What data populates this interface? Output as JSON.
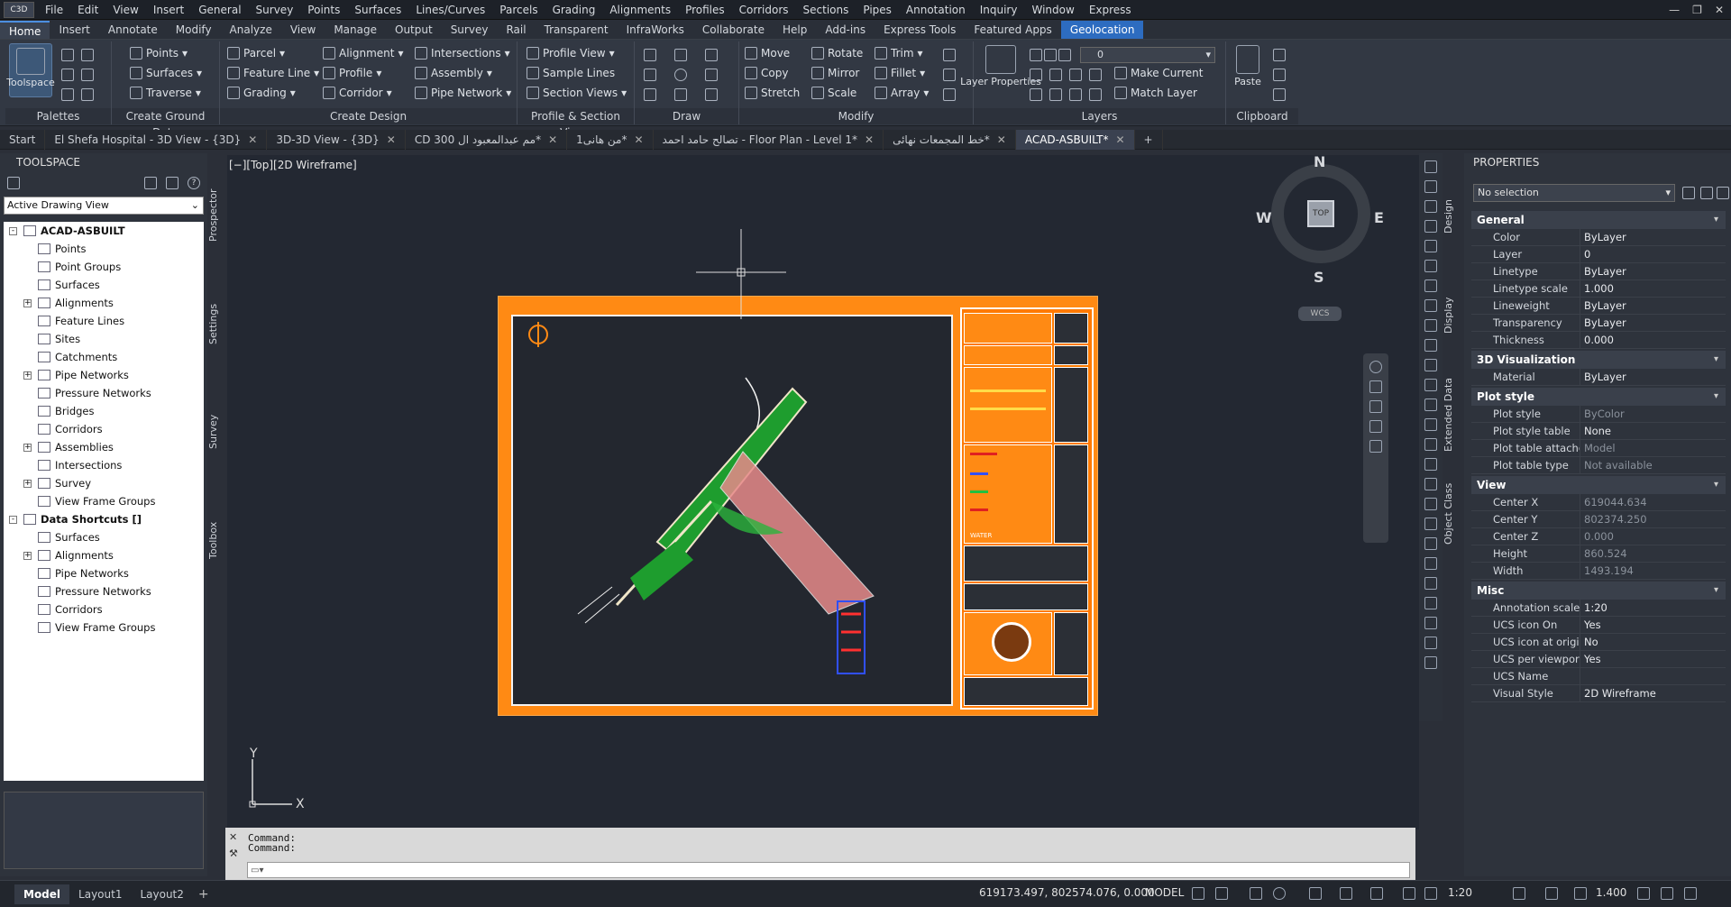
{
  "app": {
    "logo": "C3D"
  },
  "menu": [
    "File",
    "Edit",
    "View",
    "Insert",
    "General",
    "Survey",
    "Points",
    "Surfaces",
    "Lines/Curves",
    "Parcels",
    "Grading",
    "Alignments",
    "Profiles",
    "Corridors",
    "Sections",
    "Pipes",
    "Annotation",
    "Inquiry",
    "Window",
    "Express"
  ],
  "ribbon_tabs": [
    "Home",
    "Insert",
    "Annotate",
    "Modify",
    "Analyze",
    "View",
    "Manage",
    "Output",
    "Survey",
    "Rail",
    "Transparent",
    "InfraWorks",
    "Collaborate",
    "Help",
    "Add-ins",
    "Express Tools",
    "Featured Apps",
    "Geolocation"
  ],
  "ribbon": {
    "palettes": {
      "title": "Palettes",
      "toolspace": "Toolspace"
    },
    "ground": {
      "title": "Create Ground Data",
      "b1": "Points",
      "b2": "Surfaces",
      "b3": "Traverse"
    },
    "design": {
      "title": "Create Design",
      "b1": "Parcel",
      "b2": "Feature Line",
      "b3": "Grading",
      "b4": "Alignment",
      "b5": "Profile",
      "b6": "Corridor",
      "b7": "Intersections",
      "b8": "Assembly",
      "b9": "Pipe Network"
    },
    "profile": {
      "title": "Profile & Section Views",
      "b1": "Profile View",
      "b2": "Sample Lines",
      "b3": "Section Views"
    },
    "draw": {
      "title": "Draw"
    },
    "modify": {
      "title": "Modify",
      "b1": "Move",
      "b2": "Copy",
      "b3": "Stretch",
      "b4": "Rotate",
      "b5": "Mirror",
      "b6": "Scale",
      "b7": "Trim",
      "b8": "Fillet",
      "b9": "Array"
    },
    "layers": {
      "title": "Layers",
      "layer_props": "Layer Properties",
      "current_layer": "0",
      "make_current": "Make Current",
      "match_layer": "Match Layer"
    },
    "clipboard": {
      "title": "Clipboard",
      "paste": "Paste"
    }
  },
  "doc_tabs": [
    "Start",
    "El Shefa Hospital - 3D View - {3D}",
    "3D-3D View - {3D}",
    "CD 300 مم عبدالمعبود ال*",
    "من هانى1*",
    "تصالح حامد احمد - Floor Plan - Level 1*",
    "خط المجمعات نهائى*",
    "ACAD-ASBUILT*"
  ],
  "toolspace": {
    "title": "TOOLSPACE",
    "view_select": "Active Drawing View",
    "tree": [
      {
        "label": "ACAD-ASBUILT",
        "level": 0,
        "exp": "-"
      },
      {
        "label": "Points",
        "level": 1,
        "exp": ""
      },
      {
        "label": "Point Groups",
        "level": 1,
        "exp": ""
      },
      {
        "label": "Surfaces",
        "level": 1,
        "exp": ""
      },
      {
        "label": "Alignments",
        "level": 1,
        "exp": "+"
      },
      {
        "label": "Feature Lines",
        "level": 1,
        "exp": ""
      },
      {
        "label": "Sites",
        "level": 1,
        "exp": ""
      },
      {
        "label": "Catchments",
        "level": 1,
        "exp": ""
      },
      {
        "label": "Pipe Networks",
        "level": 1,
        "exp": "+"
      },
      {
        "label": "Pressure Networks",
        "level": 1,
        "exp": ""
      },
      {
        "label": "Bridges",
        "level": 1,
        "exp": ""
      },
      {
        "label": "Corridors",
        "level": 1,
        "exp": ""
      },
      {
        "label": "Assemblies",
        "level": 1,
        "exp": "+"
      },
      {
        "label": "Intersections",
        "level": 1,
        "exp": ""
      },
      {
        "label": "Survey",
        "level": 1,
        "exp": "+"
      },
      {
        "label": "View Frame Groups",
        "level": 1,
        "exp": ""
      },
      {
        "label": "Data Shortcuts []",
        "level": 0,
        "exp": "-"
      },
      {
        "label": "Surfaces",
        "level": 1,
        "exp": ""
      },
      {
        "label": "Alignments",
        "level": 1,
        "exp": "+"
      },
      {
        "label": "Pipe Networks",
        "level": 1,
        "exp": ""
      },
      {
        "label": "Pressure Networks",
        "level": 1,
        "exp": ""
      },
      {
        "label": "Corridors",
        "level": 1,
        "exp": ""
      },
      {
        "label": "View Frame Groups",
        "level": 1,
        "exp": ""
      }
    ],
    "vtabs": [
      "Prospector",
      "Settings",
      "Survey",
      "Toolbox"
    ]
  },
  "viewport": {
    "label": "[−][Top][2D Wireframe]",
    "compass": {
      "n": "N",
      "s": "S",
      "e": "E",
      "w": "W",
      "top": "TOP"
    },
    "wcs": "WCS",
    "ucs_x": "X",
    "ucs_y": "Y",
    "title_block_water": "WATER"
  },
  "command": {
    "line1": "Command:",
    "line2": "Command:"
  },
  "properties": {
    "title": "PROPERTIES",
    "selection": "No selection",
    "vtabs": [
      "Design",
      "Display",
      "Extended Data",
      "Object Class"
    ],
    "categories": [
      {
        "name": "General",
        "rows": [
          [
            "Color",
            "ByLayer"
          ],
          [
            "Layer",
            "0"
          ],
          [
            "Linetype",
            "ByLayer"
          ],
          [
            "Linetype scale",
            "1.000"
          ],
          [
            "Lineweight",
            "ByLayer"
          ],
          [
            "Transparency",
            "ByLayer"
          ],
          [
            "Thickness",
            "0.000"
          ]
        ]
      },
      {
        "name": "3D Visualization",
        "rows": [
          [
            "Material",
            "ByLayer"
          ]
        ]
      },
      {
        "name": "Plot style",
        "rows": [
          [
            "Plot style",
            "ByColor"
          ],
          [
            "Plot style table",
            "None"
          ],
          [
            "Plot table attached...",
            "Model"
          ],
          [
            "Plot table type",
            "Not available"
          ]
        ]
      },
      {
        "name": "View",
        "rows": [
          [
            "Center X",
            "619044.634"
          ],
          [
            "Center Y",
            "802374.250"
          ],
          [
            "Center Z",
            "0.000"
          ],
          [
            "Height",
            "860.524"
          ],
          [
            "Width",
            "1493.194"
          ]
        ]
      },
      {
        "name": "Misc",
        "rows": [
          [
            "Annotation scale",
            "1:20"
          ],
          [
            "UCS icon On",
            "Yes"
          ],
          [
            "UCS icon at origin",
            "No"
          ],
          [
            "UCS per viewport",
            "Yes"
          ],
          [
            "UCS Name",
            ""
          ],
          [
            "Visual Style",
            "2D Wireframe"
          ]
        ]
      }
    ]
  },
  "status": {
    "layout_tabs": [
      "Model",
      "Layout1",
      "Layout2"
    ],
    "coords": "619173.497, 802574.076, 0.000",
    "mode": "MODEL",
    "scale": "1:20",
    "zoom": "1.400"
  }
}
